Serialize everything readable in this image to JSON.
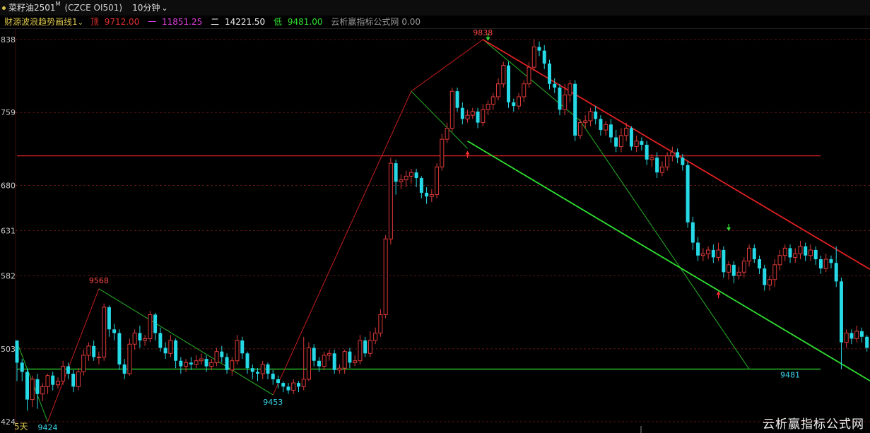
{
  "header": {
    "symbol": "菜籽油2501",
    "superscript": "M",
    "code": "(CZCE OI501)",
    "period": "10分钟",
    "period_icon": "chevron-down-icon"
  },
  "indicator": {
    "name": "财源波浪趋势画线1",
    "name_icon": "chevron-down-icon",
    "items": [
      {
        "label": "顶",
        "value": "9712.00",
        "color": "#e03030"
      },
      {
        "label": "一",
        "value": "11851.25",
        "color": "#e040e0"
      },
      {
        "label": "二",
        "value": "14221.50",
        "color": "#f0f0f0"
      },
      {
        "label": "低",
        "value": "9481.00",
        "color": "#30e030"
      }
    ],
    "tail_label": "云析赢指标公式网",
    "tail_value": "0.00"
  },
  "watermark": "云析赢指标公式网",
  "colors": {
    "up": "#e03a3a",
    "down": "#26d9e6",
    "grid": "#5a1515",
    "resistance": "#e02020",
    "support": "#30e030",
    "axis_text": "#c8c8c8"
  },
  "chart_data": {
    "type": "candlestick",
    "y_ticks": [
      {
        "value": 9838,
        "label": "838"
      },
      {
        "value": 9759,
        "label": "759"
      },
      {
        "value": 9680,
        "label": "680"
      },
      {
        "value": 9631,
        "label": "631"
      },
      {
        "value": 9582,
        "label": "582"
      },
      {
        "value": 9503,
        "label": "503"
      },
      {
        "value": 9424,
        "label": "424"
      }
    ],
    "ylim": [
      9418,
      9848
    ],
    "x_label": "5天",
    "candles": [
      [
        9512,
        9488,
        9512,
        9468
      ],
      [
        9488,
        9478,
        9492,
        9468
      ],
      [
        9478,
        9448,
        9482,
        9436
      ],
      [
        9448,
        9470,
        9474,
        9440
      ],
      [
        9470,
        9454,
        9476,
        9438
      ],
      [
        9454,
        9462,
        9466,
        9446
      ],
      [
        9462,
        9474,
        9476,
        9454
      ],
      [
        9474,
        9464,
        9478,
        9458
      ],
      [
        9464,
        9468,
        9472,
        9460
      ],
      [
        9468,
        9484,
        9490,
        9464
      ],
      [
        9484,
        9476,
        9488,
        9470
      ],
      [
        9476,
        9462,
        9480,
        9456
      ],
      [
        9462,
        9478,
        9482,
        9458
      ],
      [
        9478,
        9496,
        9502,
        9474
      ],
      [
        9496,
        9506,
        9510,
        9490
      ],
      [
        9506,
        9494,
        9512,
        9490
      ],
      [
        9494,
        9494,
        9500,
        9486
      ],
      [
        9494,
        9548,
        9552,
        9490
      ],
      [
        9548,
        9524,
        9550,
        9516
      ],
      [
        9524,
        9520,
        9530,
        9512
      ],
      [
        9520,
        9486,
        9524,
        9480
      ],
      [
        9486,
        9476,
        9492,
        9470
      ],
      [
        9476,
        9508,
        9514,
        9474
      ],
      [
        9508,
        9520,
        9524,
        9502
      ],
      [
        9520,
        9512,
        9528,
        9504
      ],
      [
        9512,
        9514,
        9518,
        9506
      ],
      [
        9514,
        9540,
        9544,
        9510
      ],
      [
        9540,
        9520,
        9542,
        9512
      ],
      [
        9520,
        9504,
        9526,
        9500
      ],
      [
        9504,
        9498,
        9510,
        9492
      ],
      [
        9498,
        9512,
        9518,
        9494
      ],
      [
        9512,
        9490,
        9514,
        9482
      ],
      [
        9490,
        9484,
        9494,
        9476
      ],
      [
        9484,
        9488,
        9492,
        9478
      ],
      [
        9488,
        9486,
        9494,
        9480
      ],
      [
        9486,
        9490,
        9496,
        9482
      ],
      [
        9490,
        9492,
        9498,
        9486
      ],
      [
        9492,
        9484,
        9496,
        9478
      ],
      [
        9484,
        9488,
        9492,
        9480
      ],
      [
        9488,
        9500,
        9504,
        9484
      ],
      [
        9500,
        9494,
        9506,
        9488
      ],
      [
        9494,
        9480,
        9498,
        9476
      ],
      [
        9480,
        9490,
        9494,
        9474
      ],
      [
        9490,
        9512,
        9518,
        9486
      ],
      [
        9512,
        9498,
        9516,
        9492
      ],
      [
        9498,
        9482,
        9500,
        9476
      ],
      [
        9482,
        9478,
        9486,
        9470
      ],
      [
        9478,
        9476,
        9482,
        9468
      ],
      [
        9476,
        9486,
        9490,
        9470
      ],
      [
        9486,
        9476,
        9488,
        9470
      ],
      [
        9476,
        9470,
        9480,
        9464
      ],
      [
        9470,
        9466,
        9474,
        9460
      ],
      [
        9466,
        9462,
        9468,
        9456
      ],
      [
        9462,
        9458,
        9466,
        9454
      ],
      [
        9458,
        9466,
        9470,
        9454
      ],
      [
        9466,
        9462,
        9468,
        9456
      ],
      [
        9462,
        9470,
        9516,
        9458
      ],
      [
        9470,
        9504,
        9510,
        9468
      ],
      [
        9504,
        9490,
        9508,
        9484
      ],
      [
        9490,
        9484,
        9494,
        9478
      ],
      [
        9484,
        9496,
        9500,
        9480
      ],
      [
        9496,
        9498,
        9502,
        9490
      ],
      [
        9498,
        9480,
        9502,
        9476
      ],
      [
        9480,
        9482,
        9486,
        9476
      ],
      [
        9482,
        9500,
        9502,
        9476
      ],
      [
        9500,
        9488,
        9504,
        9482
      ],
      [
        9488,
        9490,
        9496,
        9484
      ],
      [
        9490,
        9512,
        9518,
        9486
      ],
      [
        9512,
        9498,
        9516,
        9494
      ],
      [
        9498,
        9512,
        9522,
        9494
      ],
      [
        9512,
        9520,
        9526,
        9508
      ],
      [
        9520,
        9540,
        9546,
        9516
      ],
      [
        9540,
        9622,
        9626,
        9536
      ],
      [
        9622,
        9704,
        9710,
        9616
      ],
      [
        9704,
        9684,
        9708,
        9670
      ],
      [
        9684,
        9686,
        9692,
        9676
      ],
      [
        9686,
        9690,
        9696,
        9678
      ],
      [
        9690,
        9694,
        9698,
        9682
      ],
      [
        9694,
        9688,
        9698,
        9678
      ],
      [
        9688,
        9672,
        9690,
        9666
      ],
      [
        9672,
        9668,
        9678,
        9660
      ],
      [
        9668,
        9670,
        9676,
        9662
      ],
      [
        9670,
        9700,
        9704,
        9666
      ],
      [
        9700,
        9730,
        9736,
        9696
      ],
      [
        9730,
        9742,
        9748,
        9726
      ],
      [
        9742,
        9782,
        9786,
        9738
      ],
      [
        9782,
        9764,
        9786,
        9760
      ],
      [
        9764,
        9752,
        9770,
        9746
      ],
      [
        9752,
        9756,
        9762,
        9748
      ],
      [
        9756,
        9760,
        9764,
        9752
      ],
      [
        9760,
        9748,
        9764,
        9742
      ],
      [
        9748,
        9762,
        9768,
        9744
      ],
      [
        9762,
        9768,
        9772,
        9756
      ],
      [
        9768,
        9776,
        9780,
        9762
      ],
      [
        9776,
        9790,
        9796,
        9772
      ],
      [
        9790,
        9810,
        9814,
        9786
      ],
      [
        9810,
        9770,
        9814,
        9764
      ],
      [
        9770,
        9766,
        9774,
        9760
      ],
      [
        9766,
        9776,
        9780,
        9762
      ],
      [
        9776,
        9790,
        9794,
        9770
      ],
      [
        9790,
        9808,
        9814,
        9786
      ],
      [
        9808,
        9830,
        9838,
        9804
      ],
      [
        9830,
        9826,
        9836,
        9820
      ],
      [
        9826,
        9812,
        9832,
        9806
      ],
      [
        9812,
        9790,
        9816,
        9784
      ],
      [
        9790,
        9786,
        9796,
        9780
      ],
      [
        9786,
        9762,
        9790,
        9756
      ],
      [
        9762,
        9778,
        9790,
        9756
      ],
      [
        9778,
        9790,
        9794,
        9770
      ],
      [
        9790,
        9734,
        9794,
        9728
      ],
      [
        9734,
        9748,
        9752,
        9730
      ],
      [
        9748,
        9750,
        9756,
        9742
      ],
      [
        9750,
        9760,
        9764,
        9744
      ],
      [
        9760,
        9752,
        9766,
        9746
      ],
      [
        9752,
        9740,
        9756,
        9734
      ],
      [
        9740,
        9746,
        9750,
        9734
      ],
      [
        9746,
        9732,
        9752,
        9726
      ],
      [
        9732,
        9722,
        9740,
        9716
      ],
      [
        9722,
        9734,
        9742,
        9716
      ],
      [
        9734,
        9742,
        9748,
        9728
      ],
      [
        9742,
        9722,
        9744,
        9718
      ],
      [
        9722,
        9728,
        9734,
        9716
      ],
      [
        9728,
        9724,
        9732,
        9718
      ],
      [
        9724,
        9708,
        9728,
        9702
      ],
      [
        9708,
        9710,
        9714,
        9700
      ],
      [
        9710,
        9694,
        9716,
        9688
      ],
      [
        9694,
        9700,
        9706,
        9690
      ],
      [
        9700,
        9712,
        9716,
        9696
      ],
      [
        9712,
        9716,
        9722,
        9706
      ],
      [
        9716,
        9710,
        9720,
        9704
      ],
      [
        9710,
        9702,
        9714,
        9696
      ],
      [
        9702,
        9640,
        9706,
        9634
      ],
      [
        9640,
        9618,
        9646,
        9610
      ],
      [
        9618,
        9604,
        9624,
        9598
      ],
      [
        9604,
        9606,
        9612,
        9598
      ],
      [
        9606,
        9610,
        9614,
        9600
      ],
      [
        9610,
        9602,
        9616,
        9596
      ],
      [
        9602,
        9610,
        9618,
        9598
      ],
      [
        9610,
        9586,
        9614,
        9580
      ],
      [
        9586,
        9594,
        9598,
        9578
      ],
      [
        9594,
        9582,
        9598,
        9574
      ],
      [
        9582,
        9586,
        9592,
        9578
      ],
      [
        9586,
        9598,
        9602,
        9580
      ],
      [
        9598,
        9612,
        9616,
        9592
      ],
      [
        9612,
        9600,
        9616,
        9596
      ],
      [
        9600,
        9590,
        9604,
        9584
      ],
      [
        9590,
        9572,
        9594,
        9566
      ],
      [
        9572,
        9578,
        9582,
        9566
      ],
      [
        9578,
        9594,
        9600,
        9570
      ],
      [
        9594,
        9604,
        9610,
        9588
      ],
      [
        9604,
        9612,
        9616,
        9598
      ],
      [
        9612,
        9602,
        9616,
        9596
      ],
      [
        9602,
        9606,
        9612,
        9596
      ],
      [
        9606,
        9614,
        9620,
        9600
      ],
      [
        9614,
        9604,
        9618,
        9598
      ],
      [
        9604,
        9610,
        9616,
        9598
      ],
      [
        9610,
        9600,
        9614,
        9594
      ],
      [
        9600,
        9590,
        9604,
        9584
      ],
      [
        9590,
        9600,
        9606,
        9586
      ],
      [
        9600,
        9596,
        9604,
        9590
      ],
      [
        9596,
        9576,
        9614,
        9570
      ],
      [
        9576,
        9510,
        9580,
        9481
      ],
      [
        9510,
        9520,
        9524,
        9504
      ],
      [
        9520,
        9514,
        9524,
        9508
      ],
      [
        9514,
        9522,
        9528,
        9510
      ],
      [
        9522,
        9516,
        9526,
        9510
      ],
      [
        9516,
        9504,
        9518,
        9500
      ],
      [
        9504,
        9508,
        9512,
        9498
      ],
      [
        9508,
        9500,
        9512,
        9494
      ]
    ],
    "annotations": [
      {
        "text": "9568",
        "color": "#ff4848"
      },
      {
        "text": "9453",
        "color": "#39d6e8"
      },
      {
        "text": "9424",
        "color": "#39d6e8"
      },
      {
        "text": "9838",
        "color": "#ff4848"
      },
      {
        "text": "9481",
        "color": "#39d6e8"
      }
    ],
    "hlines": [
      {
        "value": 9712,
        "color": "#e02020"
      },
      {
        "value": 9481,
        "color": "#30e030"
      }
    ]
  }
}
